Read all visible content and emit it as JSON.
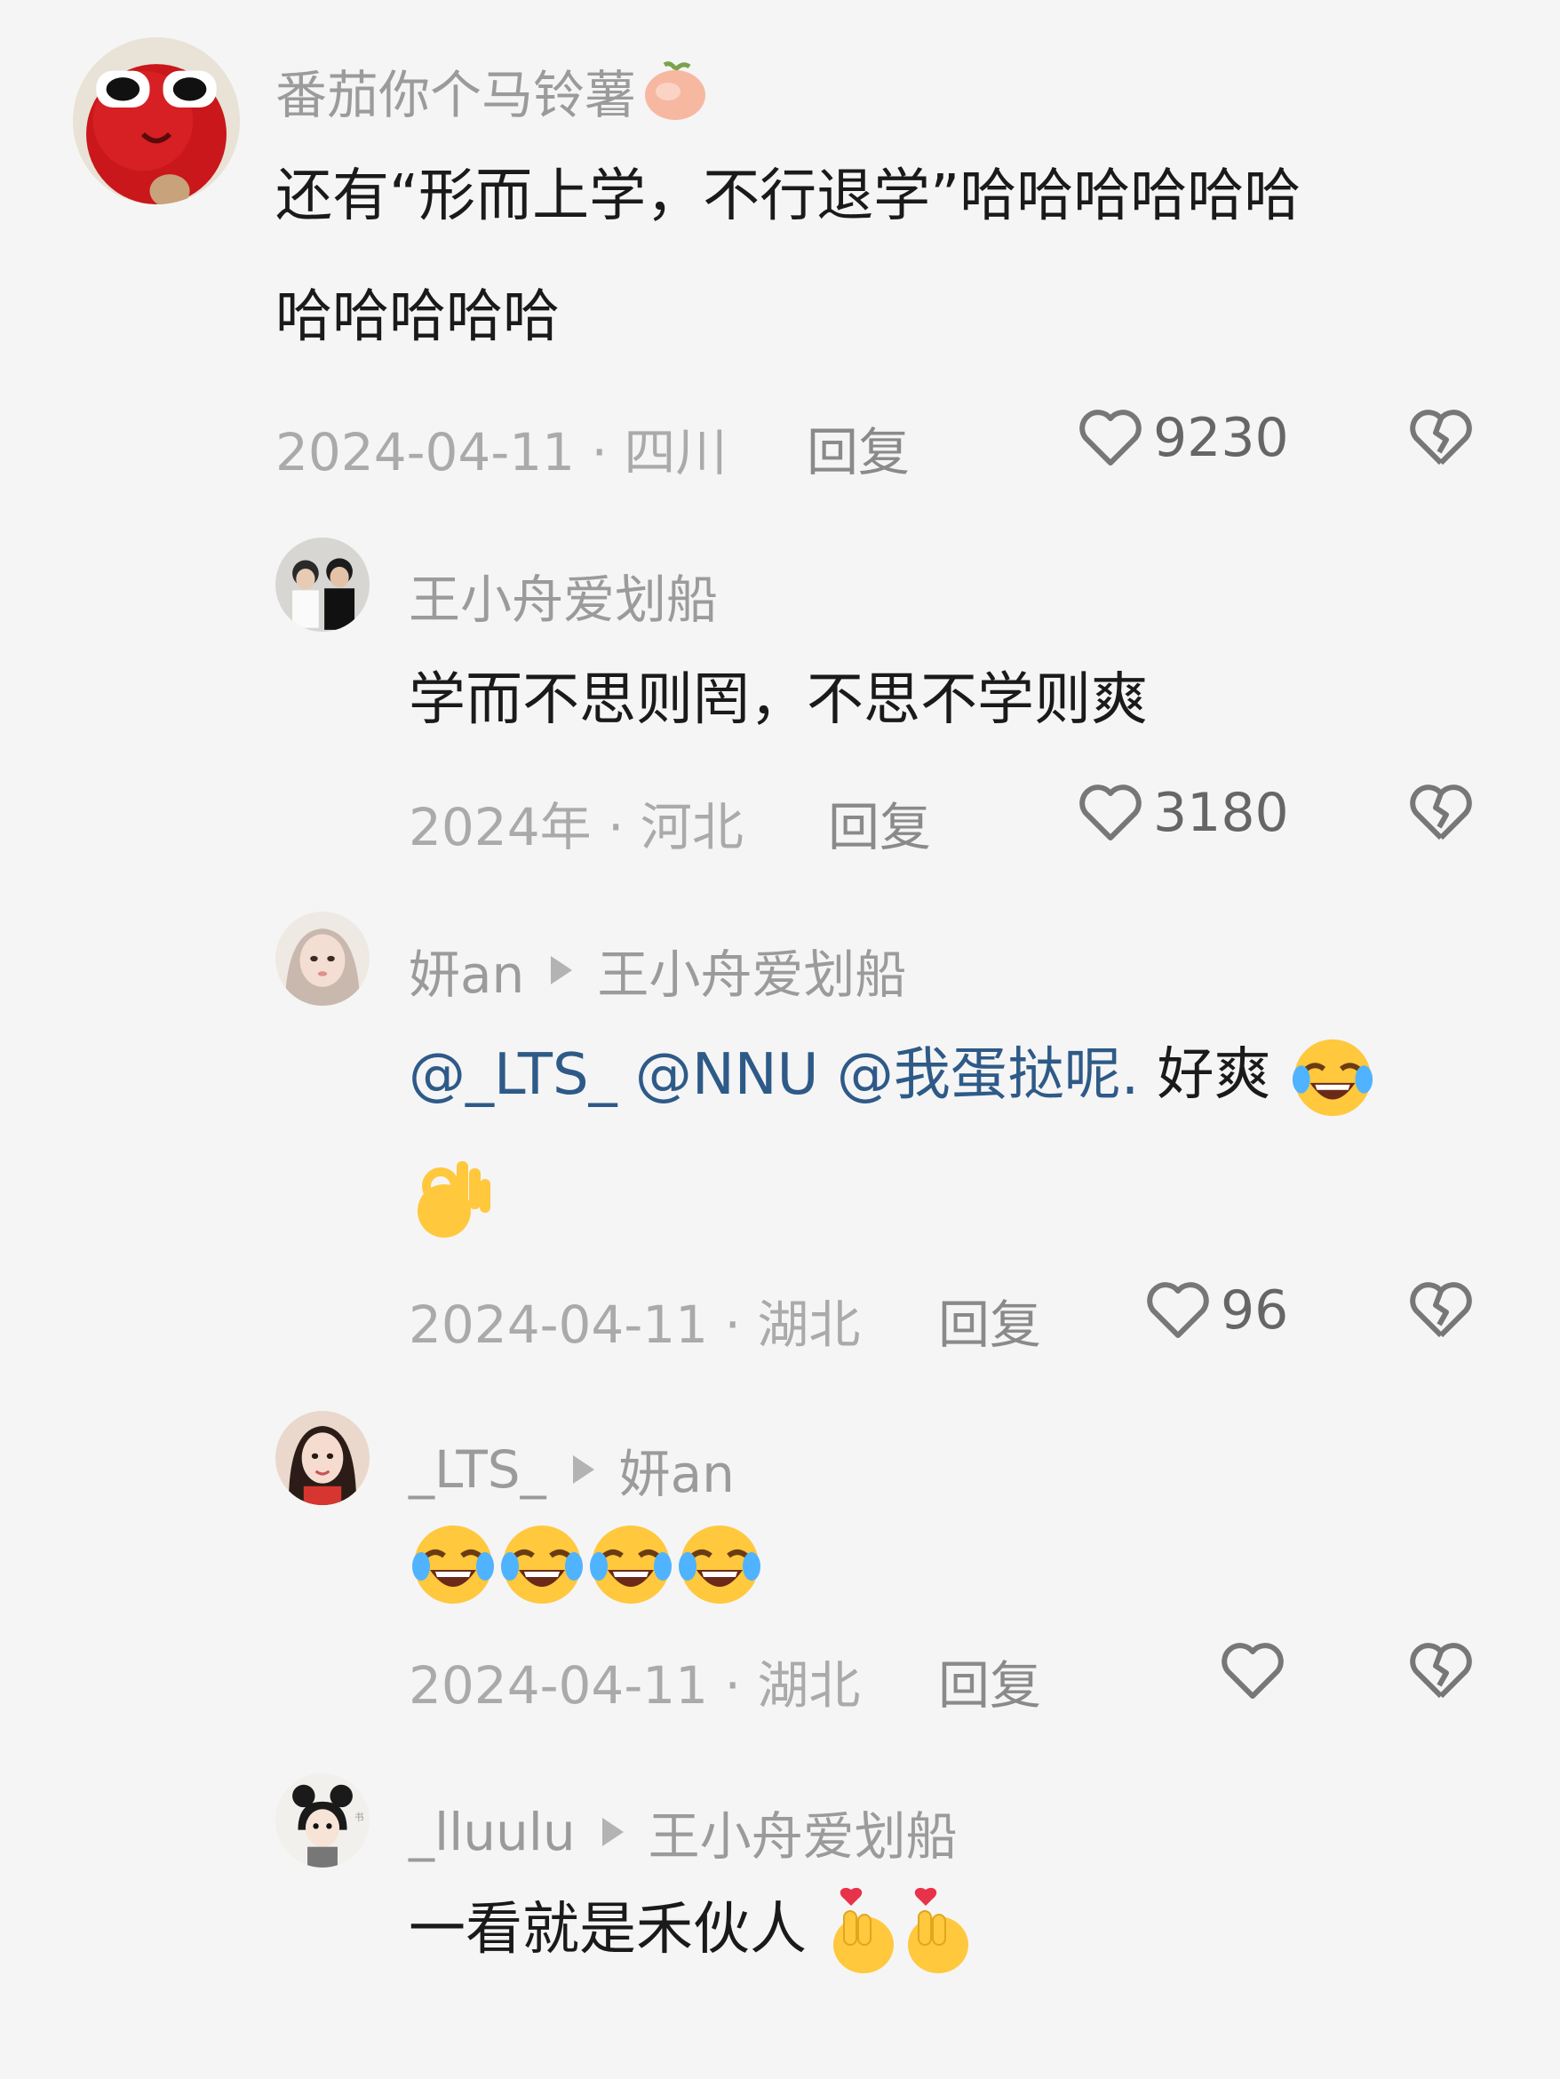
{
  "comments": [
    {
      "username": "番茄你个马铃薯",
      "text_lines": [
        "还有“形而上学，不行退学”哈哈哈哈哈哈",
        "哈哈哈哈哈"
      ],
      "date": "2024-04-11",
      "location": "四川",
      "reply_label": "回复",
      "likes": "9230"
    },
    {
      "username": "王小舟爱划船",
      "text": "学而不思则罔，不思不学则爽",
      "date": "2024年",
      "location": "河北",
      "reply_label": "回复",
      "likes": "3180"
    },
    {
      "username": "妍an",
      "reply_to": "王小舟爱划船",
      "mentions": [
        "@_LTS_",
        "@NNU",
        "@我蛋挞呢."
      ],
      "text": "好爽",
      "date": "2024-04-11",
      "location": "湖北",
      "reply_label": "回复",
      "likes": "96"
    },
    {
      "username": "_LTS_",
      "reply_to": "妍an",
      "date": "2024-04-11",
      "location": "湖北",
      "reply_label": "回复",
      "likes": ""
    },
    {
      "username": "_lluulu",
      "reply_to": "王小舟爱划船",
      "text": "一看就是禾伙人"
    }
  ],
  "icons": {
    "like": "heart-outline-icon",
    "dislike": "broken-heart-icon",
    "reply_arrow": "play-triangle-icon"
  },
  "colors": {
    "background": "#f5f5f5",
    "username": "#9b9b9b",
    "mention": "#2e5a88",
    "meta": "#aaaaaa"
  }
}
